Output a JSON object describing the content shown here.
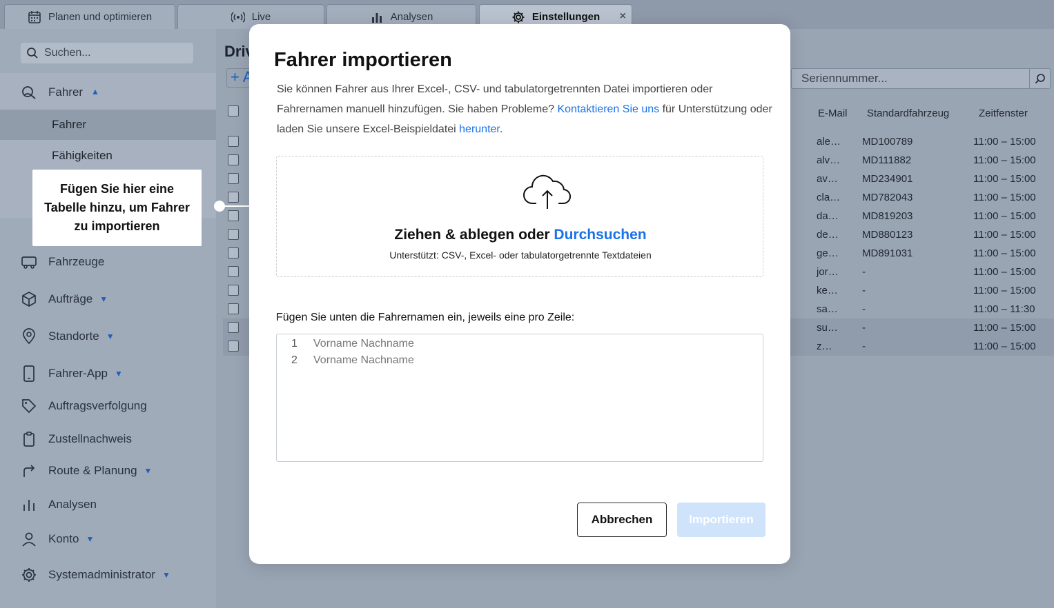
{
  "tabs": [
    {
      "label": "Planen und optimieren",
      "icon": "calendar-icon"
    },
    {
      "label": "Live",
      "icon": "broadcast-icon"
    },
    {
      "label": "Analysen",
      "icon": "bar-chart-icon"
    },
    {
      "label": "Einstellungen",
      "icon": "gear-icon",
      "active": true,
      "close": "×"
    }
  ],
  "sidebar": {
    "search_placeholder": "Suchen...",
    "group_label": "Fahrer",
    "sub_items": [
      {
        "label": "Fahrer",
        "selected": true
      },
      {
        "label": "Fähigkeiten"
      }
    ],
    "items": [
      {
        "label": "Fahrzeuge",
        "icon": "truck-icon",
        "caret": false
      },
      {
        "label": "Aufträge",
        "icon": "box-icon",
        "caret": true
      },
      {
        "label": "Standorte",
        "icon": "location-pin-icon",
        "caret": true
      },
      {
        "label": "Fahrer-App",
        "icon": "phone-icon",
        "caret": true
      },
      {
        "label": "Auftragsverfolgung",
        "icon": "tag-icon",
        "caret": false
      },
      {
        "label": "Zustellnachweis",
        "icon": "clipboard-icon",
        "caret": false
      },
      {
        "label": "Route & Planung",
        "icon": "route-arrow-icon",
        "caret": true
      },
      {
        "label": "Analysen",
        "icon": "bar-chart-icon",
        "caret": false
      },
      {
        "label": "Konto",
        "icon": "user-icon",
        "caret": true
      },
      {
        "label": "Systemadministrator",
        "icon": "gear-icon",
        "caret": true
      }
    ],
    "callout": "Fügen Sie hier eine Tabelle hinzu, um Fahrer zu importieren"
  },
  "main": {
    "title": "Driv",
    "add_label": "+ A",
    "serial_placeholder": "Seriennummer...",
    "columns": [
      "E-Mail",
      "Standardfahrzeug",
      "Zeitfenster"
    ],
    "rows": [
      {
        "email": "ale…",
        "vehicle": "MD100789",
        "window": "11:00 – 15:00"
      },
      {
        "email": "alv…",
        "vehicle": "MD111882",
        "window": "11:00 – 15:00"
      },
      {
        "email": "av…",
        "vehicle": "MD234901",
        "window": "11:00 – 15:00"
      },
      {
        "email": "cla…",
        "vehicle": "MD782043",
        "window": "11:00 – 15:00"
      },
      {
        "email": "da…",
        "vehicle": "MD819203",
        "window": "11:00 – 15:00"
      },
      {
        "email": "de…",
        "vehicle": "MD880123",
        "window": "11:00 – 15:00"
      },
      {
        "email": "ge…",
        "vehicle": "MD891031",
        "window": "11:00 – 15:00"
      },
      {
        "email": "jor…",
        "vehicle": "-",
        "window": "11:00 – 15:00"
      },
      {
        "email": "ke…",
        "vehicle": "-",
        "window": "11:00 – 15:00"
      },
      {
        "email": "sa…",
        "vehicle": "-",
        "window": "11:00 – 11:30"
      },
      {
        "email": "su…",
        "vehicle": "-",
        "window": "11:00 – 15:00"
      },
      {
        "email": "z…",
        "vehicle": "-",
        "window": "11:00 – 15:00"
      }
    ]
  },
  "modal": {
    "title": "Fahrer importieren",
    "desc_1": "Sie können Fahrer aus Ihrer Excel-, CSV- und tabulatorgetrennten Datei importieren oder Fahrernamen manuell hinzufügen. Sie haben Probleme? ",
    "desc_link_1": "Kontaktieren Sie uns",
    "desc_2": " für Unterstützung oder laden Sie unsere Excel-Beispieldatei ",
    "desc_link_2": "herunter",
    "desc_3": ".",
    "drop_title": "Ziehen & ablegen oder ",
    "drop_link": "Durchsuchen",
    "drop_sub": "Unterstützt: CSV-, Excel- oder tabulatorgetrennte Textdateien",
    "names_label": "Fügen Sie unten die Fahrernamen ein, jeweils eine pro Zeile:",
    "placeholder_lines": [
      {
        "num": "1",
        "text": "Vorname Nachname"
      },
      {
        "num": "2",
        "text": "Vorname Nachname"
      }
    ],
    "cancel_label": "Abbrechen",
    "import_label": "Importieren"
  }
}
